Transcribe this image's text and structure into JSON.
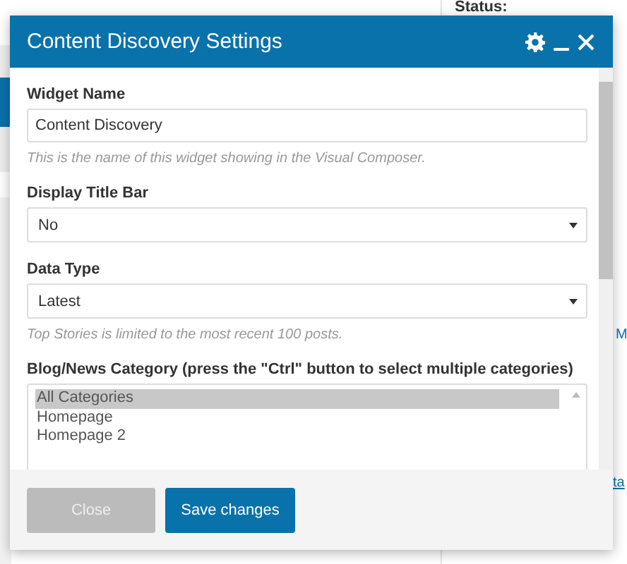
{
  "background": {
    "status_label": "Status:",
    "fragment": "M",
    "link_fragment": "ta"
  },
  "dialog": {
    "title": "Content Discovery Settings",
    "fields": [
      {
        "kind": "text",
        "label": "Widget Name",
        "value": "Content Discovery",
        "hint": "This is the name of this widget showing in the Visual Composer."
      },
      {
        "kind": "select",
        "label": "Display Title Bar",
        "value": "No"
      },
      {
        "kind": "select",
        "label": "Data Type",
        "value": "Latest",
        "hint": "Top Stories is limited to the most recent 100 posts."
      },
      {
        "kind": "listbox",
        "label": "Blog/News Category (press the \"Ctrl\" button to select multiple categories)",
        "options": [
          {
            "label": "All Categories",
            "selected": true
          },
          {
            "label": "Homepage",
            "selected": false
          },
          {
            "label": "Homepage 2",
            "selected": false
          }
        ]
      }
    ],
    "buttons": [
      {
        "label": "Close",
        "kind": "secondary"
      },
      {
        "label": "Save changes",
        "kind": "primary"
      }
    ]
  }
}
